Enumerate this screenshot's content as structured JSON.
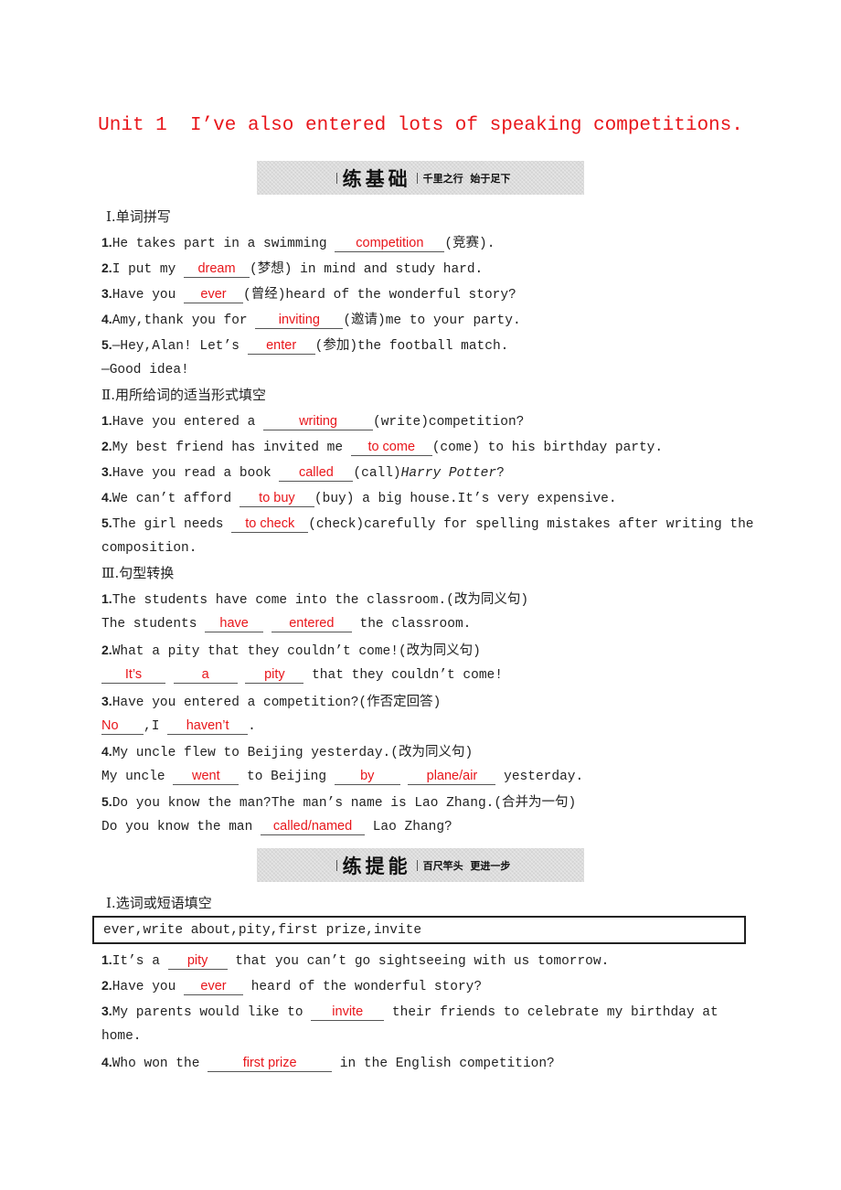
{
  "title": "Unit 1  I’ve also entered lots of speaking competitions.",
  "banner1": {
    "main": "练基础",
    "sub": "千里之行  始于足下"
  },
  "banner2": {
    "main": "练提能",
    "sub": "百尺竿头  更进一步"
  },
  "part1": {
    "sec1": {
      "heading": "Ⅰ.单词拼写",
      "items": [
        {
          "num": "1.",
          "pre": "He takes part in a swimming ",
          "answer": "competition",
          "post": "(竞赛)."
        },
        {
          "num": "2.",
          "pre": "I put my ",
          "answer": "dream",
          "post": "(梦想) in mind and study hard."
        },
        {
          "num": "3.",
          "pre": "Have you ",
          "answer": "ever",
          "post": "(曾经)heard of the wonderful story?"
        },
        {
          "num": "4.",
          "pre": "Amy,thank you for ",
          "answer": "inviting",
          "post": "(邀请)me to your party."
        },
        {
          "num": "5.",
          "pre": "—Hey,Alan! Let’s ",
          "answer": "enter",
          "post": "(参加)the football match."
        }
      ],
      "reply": "—Good idea!"
    },
    "sec2": {
      "heading": "Ⅱ.用所给词的适当形式填空",
      "items": [
        {
          "num": "1.",
          "pre": "Have you entered a ",
          "answer": "writing",
          "post": "(write)competition?"
        },
        {
          "num": "2.",
          "pre": "My best friend has invited me ",
          "answer": "to come",
          "post": "(come) to his birthday party."
        },
        {
          "num": "3.",
          "pre": "Have you read a book ",
          "answer": "called",
          "post": "(call)",
          "italic": "Harry Potter",
          "post2": "?"
        },
        {
          "num": "4.",
          "pre": "We can’t afford ",
          "answer": "to buy",
          "post": "(buy) a big house.It’s very expensive."
        },
        {
          "num": "5.",
          "pre": "The girl needs ",
          "answer": "to check",
          "post": "(check)carefully for spelling mistakes after writing the"
        }
      ],
      "continuation": "composition."
    },
    "sec3": {
      "heading": "Ⅲ.句型转换",
      "items": [
        {
          "num": "1.",
          "question": "The students have come into the classroom.(改为同义句)",
          "answer_line": {
            "pre": "The students ",
            "blanks": [
              "have",
              "entered"
            ],
            "post": " the classroom."
          }
        },
        {
          "num": "2.",
          "question": "What a pity that they couldn’t come!(改为同义句)",
          "answer_line": {
            "pre": "",
            "blanks": [
              "It’s",
              "a",
              "pity"
            ],
            "post": " that they couldn’t come!"
          }
        },
        {
          "num": "3.",
          "question": "Have you entered a competition?(作否定回答)",
          "answer_line": {
            "blanks": [
              "No",
              "haven’t"
            ],
            "mid": ",I ",
            "post": "."
          }
        },
        {
          "num": "4.",
          "question": "My uncle flew to Beijing yesterday.(改为同义句)",
          "answer_line": {
            "pre": "My uncle ",
            "blanks": [
              "went",
              "by",
              "plane/air"
            ],
            "mid": " to Beijing ",
            "post": " yesterday."
          }
        },
        {
          "num": "5.",
          "question": "Do you know the man?The man’s name is Lao Zhang.(合并为一句)",
          "answer_line": {
            "pre": "Do you know the man ",
            "blanks": [
              "called/named"
            ],
            "post": " Lao Zhang?"
          }
        }
      ]
    }
  },
  "part2": {
    "sec1": {
      "heading": "Ⅰ.选词或短语填空",
      "word_bank": "ever,write about,pity,first prize,invite",
      "items": [
        {
          "num": "1.",
          "pre": "It’s a ",
          "answer": "pity",
          "post": " that you can’t go sightseeing with us tomorrow."
        },
        {
          "num": "2.",
          "pre": "Have you ",
          "answer": "ever",
          "post": " heard of the wonderful story?"
        },
        {
          "num": "3.",
          "pre": "My parents would like to ",
          "answer": "invite",
          "post": " their friends to celebrate my birthday at"
        },
        {
          "num": "4.",
          "pre": "Who won the ",
          "answer": "first prize",
          "post": " in the English competition?"
        }
      ],
      "continuation": "home."
    }
  },
  "colors": {
    "answer": "#e8161b",
    "title": "#e8161b",
    "banner_bg": "#dcdcdc"
  }
}
